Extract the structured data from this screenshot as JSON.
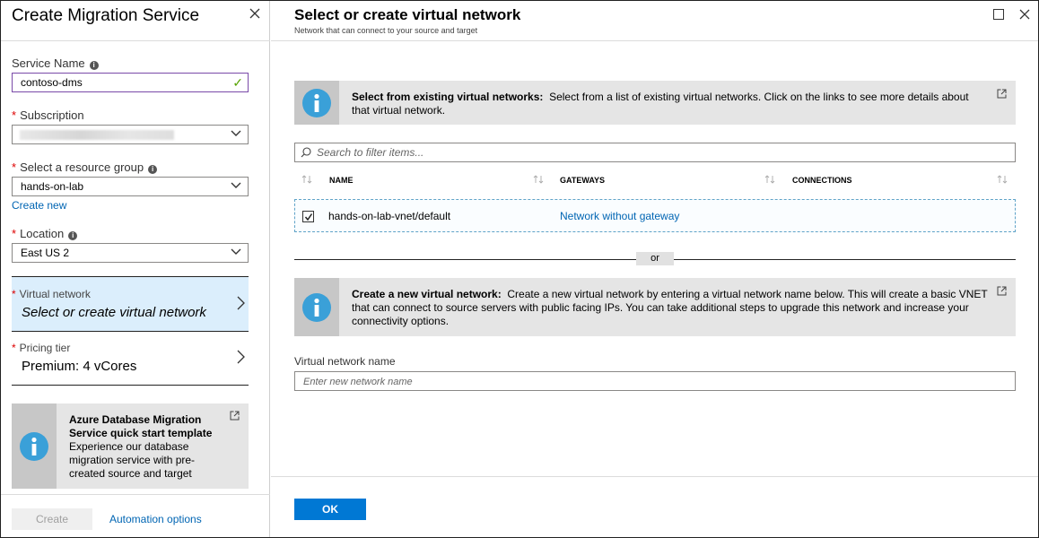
{
  "left_blade": {
    "title": "Create Migration Service",
    "service_name": {
      "label": "Service Name",
      "value": "contoso-dms"
    },
    "subscription": {
      "label": "Subscription"
    },
    "resource_group": {
      "label": "Select a resource group",
      "value": "hands-on-lab",
      "create_new": "Create new"
    },
    "location": {
      "label": "Location",
      "value": "East US 2"
    },
    "virtual_network": {
      "label": "Virtual network",
      "value": "Select or create virtual network"
    },
    "pricing_tier": {
      "label": "Pricing tier",
      "value": "Premium: 4 vCores"
    },
    "template_card": {
      "title": "Azure Database Migration Service quick start template",
      "description": "Experience our database migration service with pre-created source and target"
    },
    "create_button": "Create",
    "automation_link": "Automation options"
  },
  "right_blade": {
    "title": "Select or create virtual network",
    "subtitle": "Network that can connect to your source and target",
    "existing_info": {
      "heading": "Select from existing virtual networks:",
      "text": "Select from a list of existing virtual networks. Click on the links to see more details about that virtual network."
    },
    "search_placeholder": "Search to filter items...",
    "table": {
      "columns": [
        "NAME",
        "GATEWAYS",
        "CONNECTIONS"
      ],
      "rows": [
        {
          "name": "hands-on-lab-vnet/default",
          "gateway": "Network without gateway",
          "connections": "",
          "checked": true
        }
      ]
    },
    "or_label": "or",
    "create_info": {
      "heading": "Create a new virtual network:",
      "text": "Create a new virtual network by entering a virtual network name below. This will create a basic VNET that can connect to source servers with public facing IPs. You can take additional steps to upgrade this network and increase your connectivity options."
    },
    "vnet_name_label": "Virtual network name",
    "vnet_name_placeholder": "Enter new network name",
    "ok_button": "OK"
  },
  "colors": {
    "accent": "#0078d4",
    "link": "#0065b3",
    "selected_bg": "#dbeefc",
    "valid_check": "#57a300"
  },
  "icons": [
    "close-icon",
    "info-icon",
    "checkmark-icon",
    "chevron-down-icon",
    "chevron-right-icon",
    "external-link-icon",
    "maximize-icon",
    "search-icon",
    "sort-icon",
    "checkbox-checked-icon"
  ]
}
